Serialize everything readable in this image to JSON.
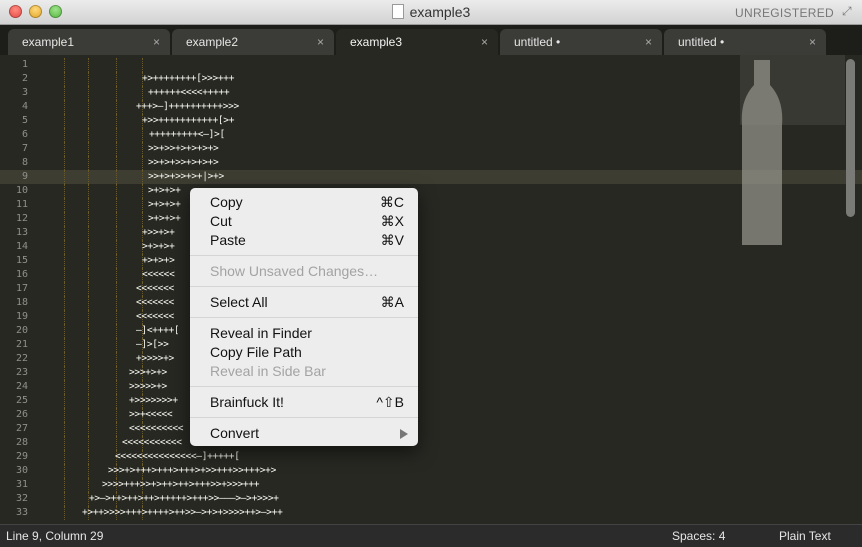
{
  "window": {
    "title": "example3",
    "badge": "UNREGISTERED"
  },
  "tabs": [
    {
      "label": "example1",
      "close": "×"
    },
    {
      "label": "example2",
      "close": "×"
    },
    {
      "label": "example3",
      "close": "×",
      "active": true
    },
    {
      "label": "untitled •",
      "close": "×"
    },
    {
      "label": "untitled •",
      "close": "×"
    }
  ],
  "editor": {
    "line_numbers": [
      "1",
      "2",
      "3",
      "4",
      "5",
      "6",
      "7",
      "8",
      "9",
      "10",
      "11",
      "12",
      "13",
      "14",
      "15",
      "16",
      "17",
      "18",
      "19",
      "20",
      "21",
      "22",
      "23",
      "24",
      "25",
      "26",
      "27",
      "28",
      "29",
      "30",
      "31",
      "32",
      "33"
    ],
    "current_line": 9,
    "code": [
      "",
      "+>++++++++[>>>+++",
      "++++++<<<<+++++",
      "+++>–]++++++++++>>>",
      "+>>+++++++++++[>+",
      "+++++++++<–]>[",
      ">>+>>+>+>+>+>",
      ">>+>+>>+>+>+>",
      ">>+>+>>+>+|>+>",
      ">+>+>+",
      ">+>+>+",
      ">+>+>+",
      "+>>+>+",
      ">+>+>+",
      "+>+>+>",
      "<<<<<<",
      "<<<<<<<",
      "<<<<<<<",
      "<<<<<<<",
      "–]<++++[",
      "–]>[>>",
      "+>>>>+>",
      ">>>+>+>",
      ">>>>>+>",
      "+>>>>>>>+",
      ">>+<<<<<",
      "<<<<<<<<<<",
      "<<<<<<<<<<<",
      "<<<<<<<<<<<<<<<–]+++++[",
      ">>>+>+++>+++>+++>+>>+++>>+++>+>",
      ">>>>+++>>+>++>++>+++>>+>>>+++",
      "+>–>++>++>++>+++++>+++>>–––>–>+>>>+",
      "+>++>>>>+++>++++>++>>–>+>+>>>>++>–>++"
    ],
    "code_offsets": [
      0,
      142,
      148,
      136,
      142,
      149,
      148,
      148,
      148,
      148,
      148,
      148,
      142,
      142,
      142,
      142,
      136,
      136,
      136,
      136,
      136,
      136,
      129,
      129,
      129,
      129,
      129,
      122,
      115,
      108,
      102,
      89,
      82
    ]
  },
  "context_menu": {
    "items": [
      {
        "label": "Copy",
        "shortcut": "⌘C"
      },
      {
        "label": "Cut",
        "shortcut": "⌘X"
      },
      {
        "label": "Paste",
        "shortcut": "⌘V"
      },
      {
        "label": "Show Unsaved Changes…",
        "shortcut": "",
        "disabled": true
      },
      {
        "label": "Select All",
        "shortcut": "⌘A"
      },
      {
        "label": "Reveal in Finder",
        "shortcut": ""
      },
      {
        "label": "Copy File Path",
        "shortcut": ""
      },
      {
        "label": "Reveal in Side Bar",
        "shortcut": "",
        "disabled": true
      },
      {
        "label": "Brainfuck It!",
        "shortcut": "^⇧B"
      },
      {
        "label": "Convert",
        "shortcut": "",
        "submenu": true
      }
    ]
  },
  "status": {
    "position": "Line 9, Column 29",
    "spaces": "Spaces: 4",
    "syntax": "Plain Text"
  },
  "colors": {
    "background": "#272822",
    "current_line": "#3e3d32",
    "text": "#f8f8f2",
    "line_number": "#8f908a"
  }
}
